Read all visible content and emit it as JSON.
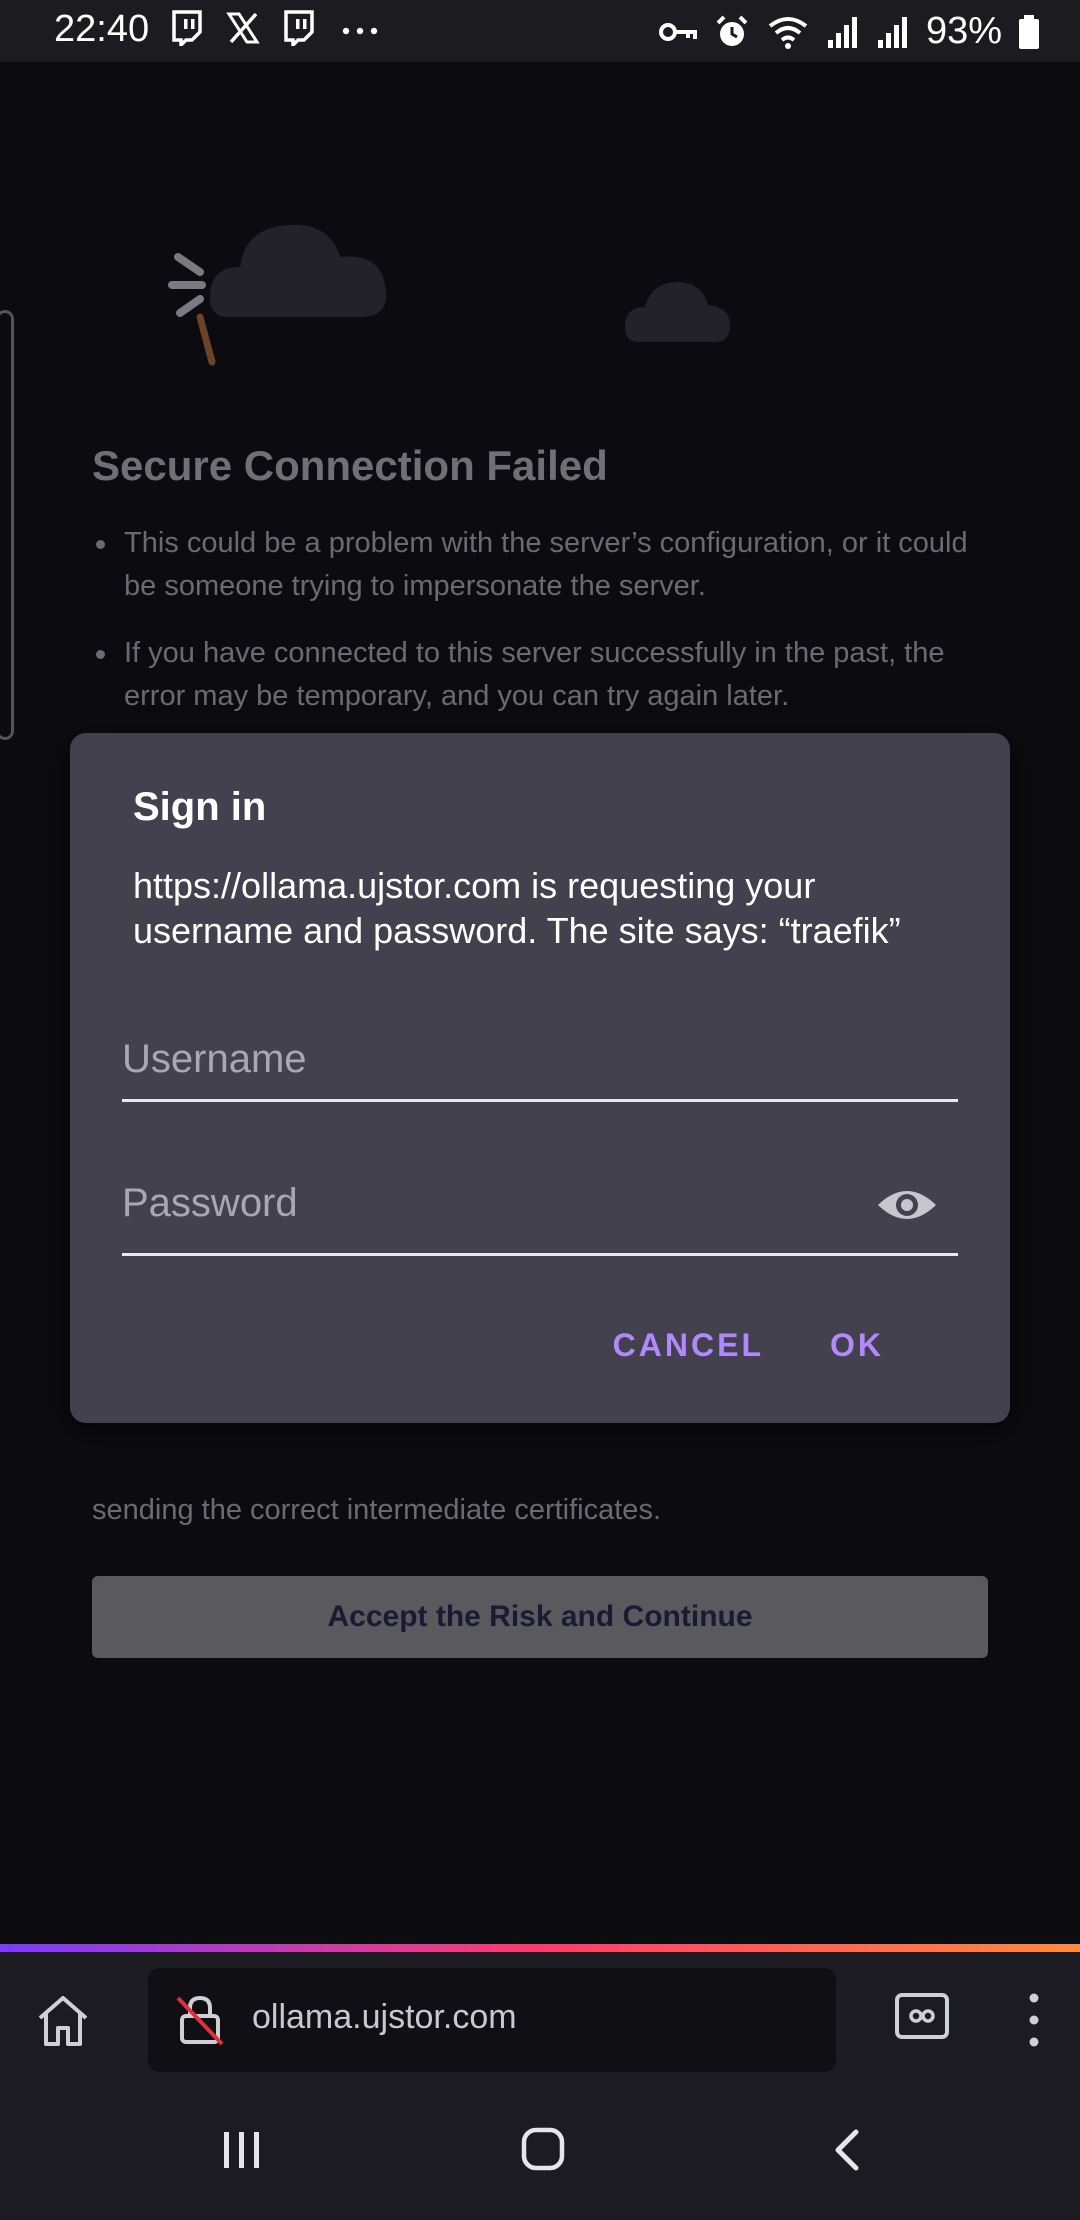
{
  "status_bar": {
    "time": "22:40",
    "left_icons": [
      "twitch-icon",
      "x-icon",
      "twitch-icon",
      "more-notifications-icon"
    ],
    "right_icons": [
      "vpn-key-icon",
      "alarm-icon",
      "wifi-icon",
      "signal-icon",
      "signal-roaming-icon",
      "battery-icon"
    ],
    "battery": "93%"
  },
  "error_page": {
    "title": "Secure Connection Failed",
    "bullets": [
      "This could be a problem with the server’s configuration, or it could be someone trying to impersonate the server.",
      "If you have connected to this server successfully in the past, the error may be temporary, and you can try again later."
    ],
    "partial_text": "sending the correct intermediate certificates.",
    "accept_button": "Accept the Risk and Continue"
  },
  "dialog": {
    "title": "Sign in",
    "message": "https://ollama.ujstor.com is requesting your username and password. The site says: “traefik”",
    "username_placeholder": "Username",
    "password_placeholder": "Password",
    "cancel_label": "CANCEL",
    "ok_label": "OK"
  },
  "browser": {
    "url": "ollama.ujstor.com"
  },
  "colors": {
    "dialog_bg": "#42414d",
    "accent": "#b388ff",
    "page_bg": "#0c0c10"
  }
}
